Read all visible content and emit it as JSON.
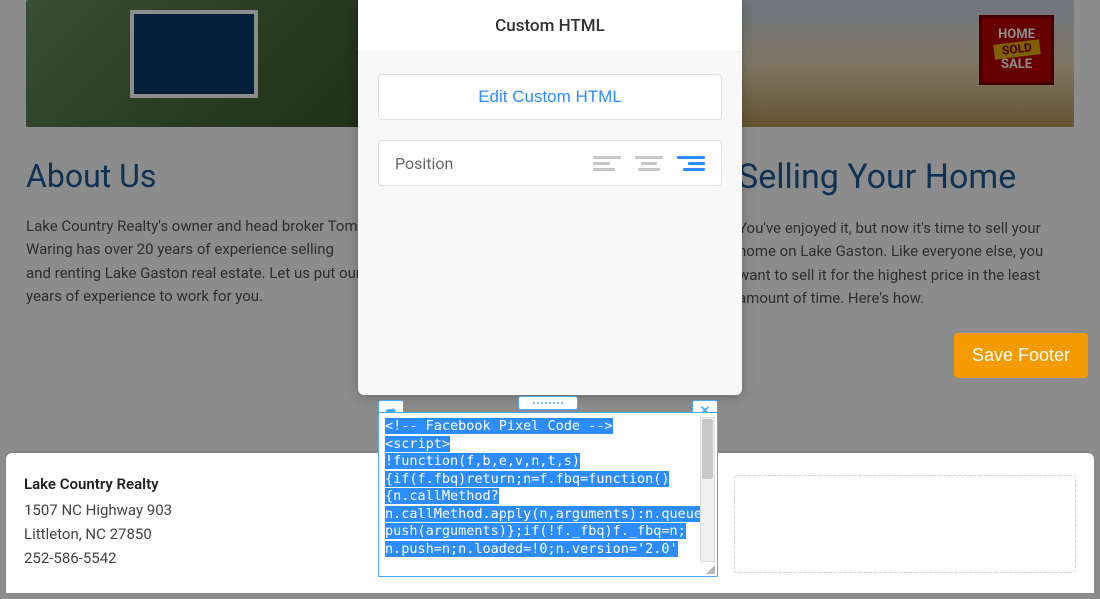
{
  "cols": {
    "about": {
      "title": "About Us",
      "text": "Lake Country Realty's owner and head broker Tom Waring has over 20 years of experience selling and renting Lake Gaston real estate.  Let us put our years of experience to work for you."
    },
    "sell": {
      "title": "Selling Your Home",
      "text": "You've enjoyed it, but now it's time to sell your home on Lake Gaston. Like everyone else, you want to sell it for the highest price in the least amount of time. Here's how."
    }
  },
  "sold_sign": {
    "top": "HOME",
    "mid": "SOLD",
    "bot": "SALE"
  },
  "save_footer_label": "Save Footer",
  "footer": {
    "name": "Lake Country Realty",
    "addr1": "1507 NC Highway 903",
    "addr2": "Littleton, NC  27850",
    "phone": "252-586-5542"
  },
  "panel": {
    "title": "Custom HTML",
    "edit_label": "Edit Custom HTML",
    "position_label": "Position",
    "selected_align": "right"
  },
  "code_arrow": "➦",
  "code_close": "✕",
  "code_text": "<!-- Facebook Pixel Code -->\n<script>\n!function(f,b,e,v,n,t,s)\n{if(f.fbq)return;n=f.fbq=function()\n{n.callMethod?\nn.callMethod.apply(n,arguments):n.queue.push(arguments)};if(!f._fbq)f._fbq=n;\nn.push=n;n.loaded=!0;n.version='2.0'"
}
